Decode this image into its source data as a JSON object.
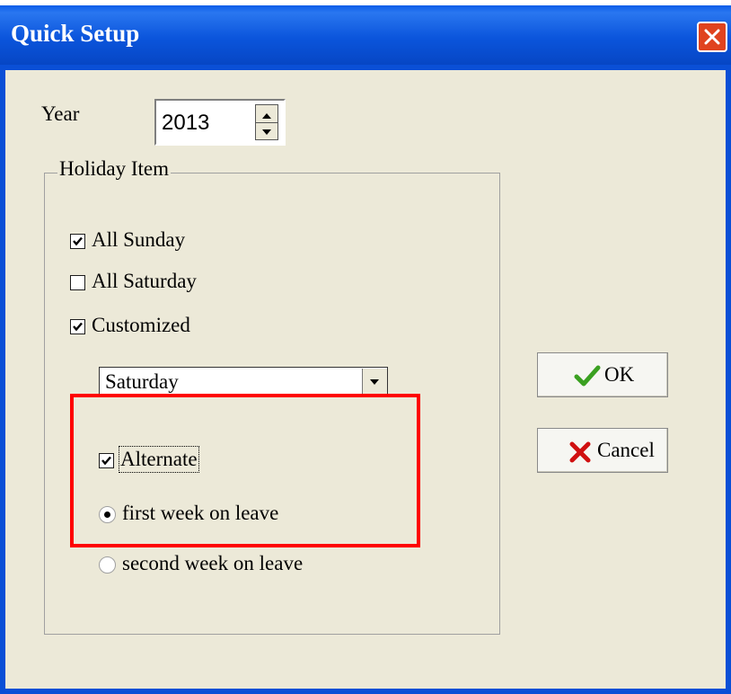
{
  "window": {
    "title": "Quick Setup"
  },
  "year": {
    "label": "Year",
    "value": "2013"
  },
  "holiday": {
    "group_label": "Holiday Item",
    "all_sunday": {
      "label": "All Sunday",
      "checked": true
    },
    "all_saturday": {
      "label": "All Saturday",
      "checked": false
    },
    "customized": {
      "label": "Customized",
      "checked": true
    },
    "day_select": {
      "value": "Saturday"
    },
    "alternate": {
      "label": "Alternate",
      "checked": true
    },
    "first_week": {
      "label": "first week on leave",
      "selected": true
    },
    "second_week": {
      "label": "second week on leave",
      "selected": false
    }
  },
  "buttons": {
    "ok_label": "OK",
    "cancel_label": "Cancel"
  },
  "colors": {
    "titlebar": "#0b55dc",
    "client": "#ece9d8",
    "highlight": "#ff0000",
    "ok_icon": "#3aa020",
    "cancel_icon": "#d01010"
  },
  "icons": {
    "ok": "checkmark-icon",
    "cancel": "x-icon",
    "close": "close-icon"
  }
}
